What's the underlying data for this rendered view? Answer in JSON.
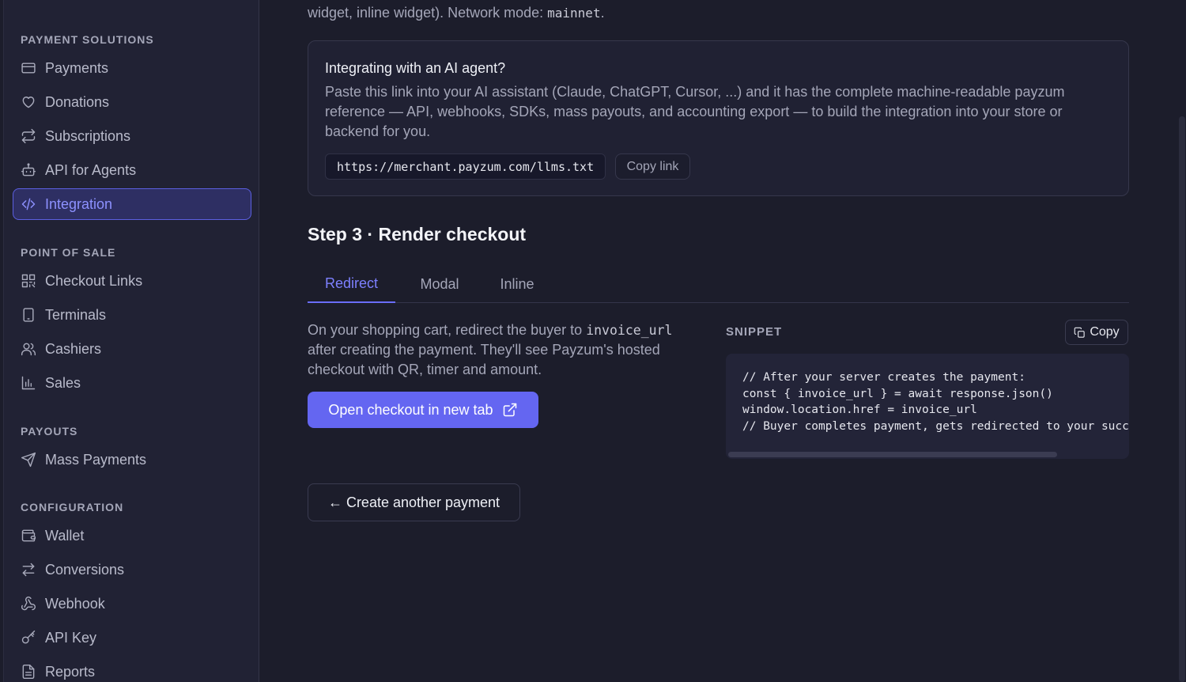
{
  "sidebar": {
    "sections": [
      {
        "title": "PAYMENT SOLUTIONS"
      },
      {
        "title": "POINT OF SALE"
      },
      {
        "title": "PAYOUTS"
      },
      {
        "title": "CONFIGURATION"
      }
    ],
    "items": [
      {
        "label": "Payments",
        "icon": "card-icon"
      },
      {
        "label": "Donations",
        "icon": "heart-icon"
      },
      {
        "label": "Subscriptions",
        "icon": "repeat-icon"
      },
      {
        "label": "API for Agents",
        "icon": "robot-icon"
      },
      {
        "label": "Integration",
        "icon": "code-icon",
        "active": true
      },
      {
        "label": "Checkout Links",
        "icon": "qr-code-icon"
      },
      {
        "label": "Terminals",
        "icon": "tablet-icon"
      },
      {
        "label": "Cashiers",
        "icon": "users-icon"
      },
      {
        "label": "Sales",
        "icon": "bar-chart-icon"
      },
      {
        "label": "Mass Payments",
        "icon": "send-icon"
      },
      {
        "label": "Wallet",
        "icon": "wallet-icon"
      },
      {
        "label": "Conversions",
        "icon": "arrows-swap-icon"
      },
      {
        "label": "Webhook",
        "icon": "webhook-icon"
      },
      {
        "label": "API Key",
        "icon": "key-icon"
      },
      {
        "label": "Reports",
        "icon": "report-icon"
      }
    ]
  },
  "main": {
    "intro_text": "widget, inline widget). Network mode: ",
    "intro_code": "mainnet",
    "intro_suffix": ".",
    "ai_card": {
      "title": "Integrating with an AI agent?",
      "description": "Paste this link into your AI assistant (Claude, ChatGPT, Cursor, ...) and it has the complete machine-readable payzum reference — API, webhooks, SDKs, mass payouts, and accounting export — to build the integration into your store or backend for you.",
      "url": "https://merchant.payzum.com/llms.txt",
      "copy_label": "Copy link"
    },
    "step_title": "Step 3 · Render checkout",
    "tabs": [
      {
        "label": "Redirect",
        "active": true
      },
      {
        "label": "Modal"
      },
      {
        "label": "Inline"
      }
    ],
    "redirect": {
      "text_before": "On your shopping cart, redirect the buyer to ",
      "text_code": "invoice_url",
      "text_after": " after creating the payment. They'll see Payzum's hosted checkout with QR, timer and amount.",
      "button_label": "Open checkout in new tab"
    },
    "snippet": {
      "label": "SNIPPET",
      "copy_label": "Copy",
      "code": "// After your server creates the payment:\nconst { invoice_url } = await response.json()\nwindow.location.href = invoice_url\n// Buyer completes payment, gets redirected to your success_url"
    },
    "another_button_label": "← Create another payment"
  }
}
